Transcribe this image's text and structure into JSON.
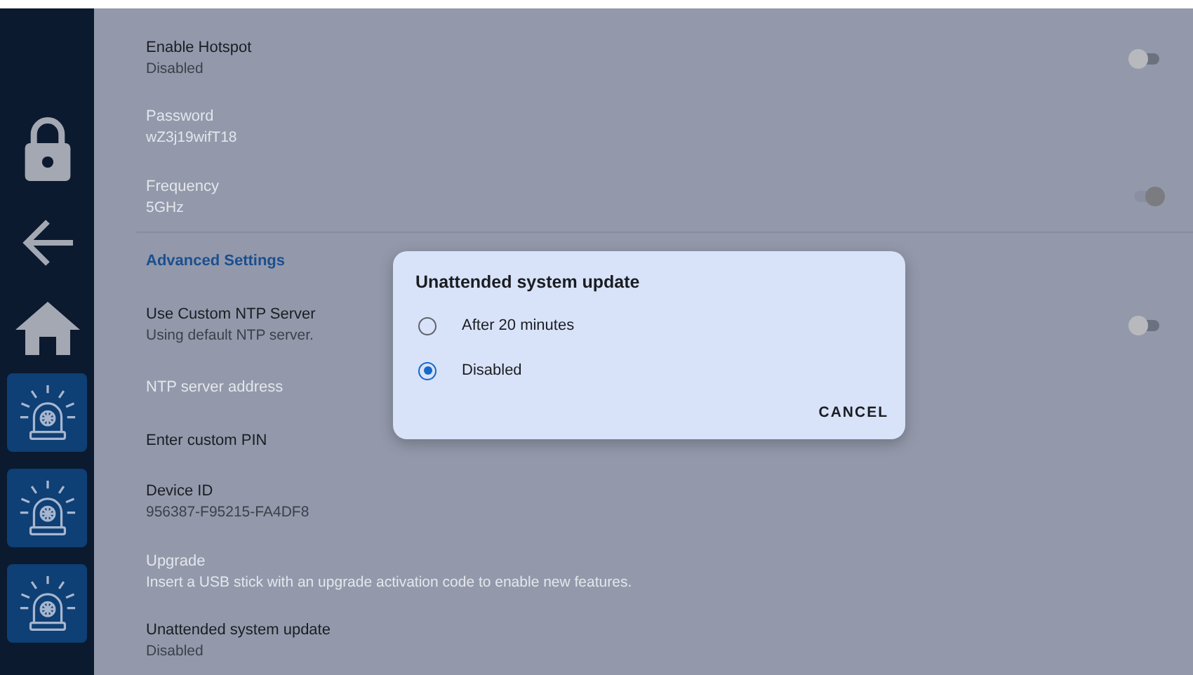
{
  "sidebar": {
    "items": [
      {
        "kind": "lock"
      },
      {
        "kind": "back"
      },
      {
        "kind": "home"
      },
      {
        "kind": "alarm"
      },
      {
        "kind": "alarm"
      },
      {
        "kind": "alarm"
      }
    ]
  },
  "settings": [
    {
      "kind": "toggle",
      "title": "Enable Hotspot",
      "subtitle": "Disabled",
      "disabled": false,
      "on": false
    },
    {
      "kind": "row",
      "title": "Password",
      "subtitle": "wZ3j19wifT18",
      "disabled": true
    },
    {
      "kind": "toggle",
      "title": "Frequency",
      "subtitle": "5GHz",
      "disabled": true,
      "on": true
    },
    {
      "kind": "divider"
    },
    {
      "kind": "header",
      "title": "Advanced Settings"
    },
    {
      "kind": "toggle",
      "title": "Use Custom NTP Server",
      "subtitle": "Using default NTP server.",
      "disabled": false,
      "on": false
    },
    {
      "kind": "row",
      "title": "NTP server address",
      "disabled": true
    },
    {
      "kind": "row",
      "title": "Enter custom PIN",
      "disabled": false
    },
    {
      "kind": "row",
      "title": "Device ID",
      "subtitle": "956387-F95215-FA4DF8",
      "disabled": false
    },
    {
      "kind": "row",
      "title": "Upgrade",
      "subtitle": "Insert a USB stick with an upgrade activation code to enable new features.",
      "disabled": true
    },
    {
      "kind": "row",
      "title": "Unattended system update",
      "subtitle": "Disabled",
      "disabled": false
    }
  ],
  "dialog": {
    "title": "Unattended system update",
    "options": [
      {
        "label": "After 20 minutes",
        "selected": false
      },
      {
        "label": "Disabled",
        "selected": true
      }
    ],
    "button": "CANCEL"
  }
}
